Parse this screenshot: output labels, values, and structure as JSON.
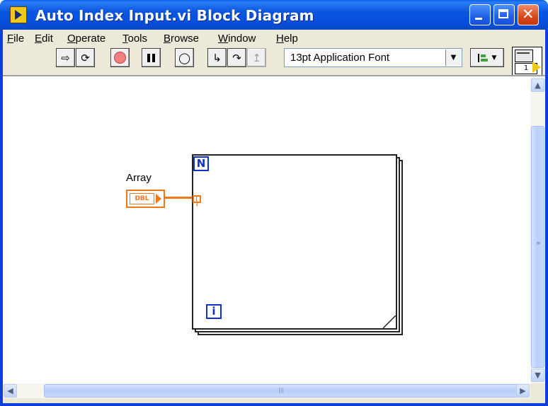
{
  "window": {
    "title": "Auto Index Input.vi Block Diagram"
  },
  "menu": {
    "items": [
      "File",
      "Edit",
      "Operate",
      "Tools",
      "Browse",
      "Window",
      "Help"
    ]
  },
  "toolbar": {
    "font_value": "13pt Application Font"
  },
  "connector_pane": {
    "number": "1"
  },
  "diagram": {
    "control_label": "Array",
    "control_type": "DBL",
    "tunnel_glyph": "[ ]",
    "count_terminal": "N",
    "iteration_terminal": "i"
  },
  "colors": {
    "titlebar": "#0a55e0",
    "array_wire": "#f07818",
    "loop_terminal": "#1030d0"
  }
}
